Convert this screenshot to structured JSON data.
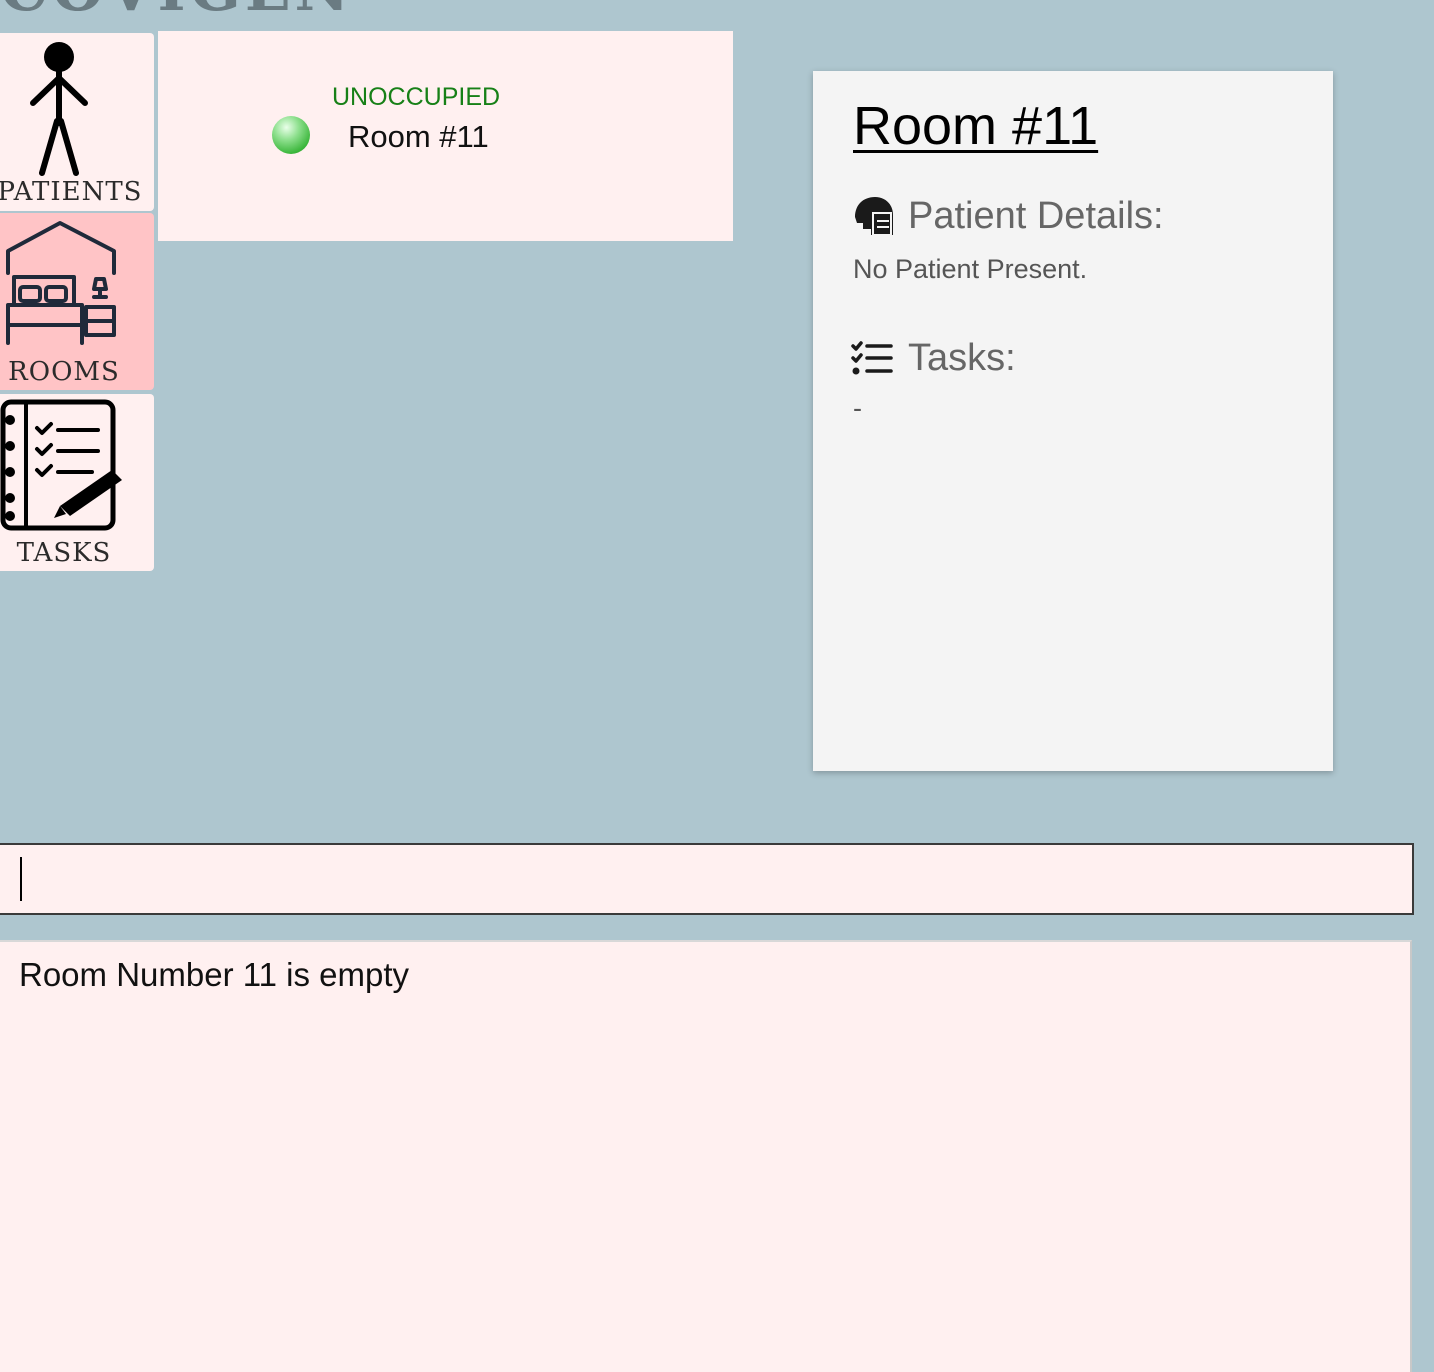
{
  "app": {
    "logo_text": "COVIGENT"
  },
  "nav": {
    "patients_label": "PATIENTS",
    "rooms_label": "ROOMS",
    "tasks_label": "TASKS"
  },
  "room_list": {
    "items": [
      {
        "status": "UNOCCUPIED",
        "name": "Room #11"
      }
    ]
  },
  "detail": {
    "title": "Room #11",
    "patient_heading": "Patient Details:",
    "patient_text": "No Patient Present.",
    "tasks_heading": "Tasks:",
    "tasks_text": "-"
  },
  "command": {
    "value": ""
  },
  "result": {
    "text": "Room Number 11 is empty"
  },
  "colors": {
    "background": "#aec6cf",
    "card": "#fff0f0",
    "active_tab": "#ffc4c6",
    "status_unoccupied": "#178017",
    "panel": "#f4f4f4"
  },
  "icons": {
    "patients": "stick-figure-icon",
    "rooms": "bedroom-house-icon",
    "tasks": "checklist-notebook-icon",
    "patient_details": "masked-head-icon",
    "tasks_section": "checklist-icon",
    "status": "green-status-dot"
  }
}
